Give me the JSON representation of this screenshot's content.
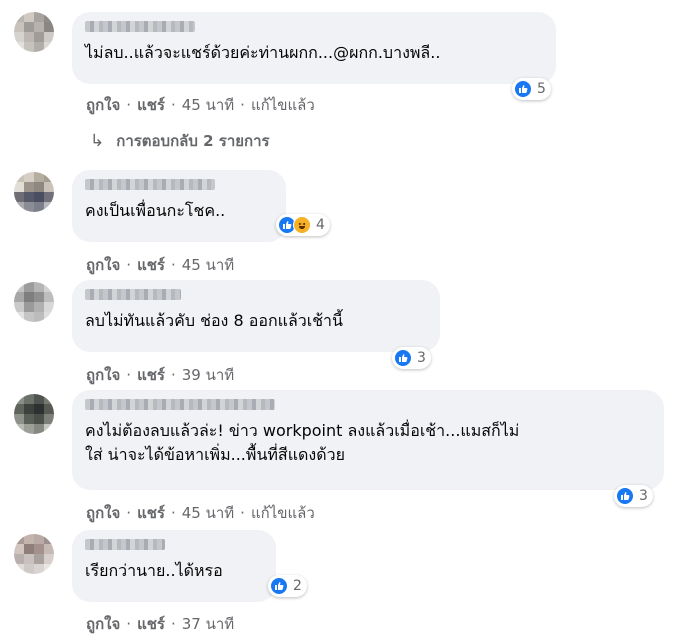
{
  "comments": [
    {
      "text": "ไม่ลบ..แล้วจะแชร์ด้วยค่ะท่านผกก...@ผกก.บางพลี..",
      "reactions": {
        "types": [
          "like"
        ],
        "count": "5"
      },
      "actions": {
        "like": "ถูกใจ",
        "share": "แชร์",
        "time": "45 นาที",
        "edited": "แก้ไขแล้ว"
      },
      "avatar_colors": [
        "#b9b6b1",
        "#cfcac4",
        "#a7a39e",
        "#8f8c88",
        "#c9c3bd",
        "#9f9b96",
        "#b7b2ad",
        "#8a8783",
        "#d6d2cd",
        "#bdb8b3",
        "#a09c98",
        "#cfcac6",
        "#e3e0dc",
        "#c6c2be",
        "#b1ada9",
        "#dcd9d5"
      ]
    },
    {
      "text": "คงเป็นเพื่อนกะโชค..",
      "reactions": {
        "types": [
          "like",
          "haha"
        ],
        "count": "4"
      },
      "actions": {
        "like": "ถูกใจ",
        "share": "แชร์",
        "time": "45 นาที"
      },
      "avatar_colors": [
        "#c8c2b8",
        "#d6cfc5",
        "#b5ad9f",
        "#a39d92",
        "#e2ddd5",
        "#9b958b",
        "#8d8880",
        "#c9c3ba",
        "#6e6d74",
        "#55596a",
        "#4a4e60",
        "#717079",
        "#a9a8ad",
        "#8a8c96",
        "#7c7f8a",
        "#b8b7bb"
      ]
    },
    {
      "text": "ลบไม่ทันแล้วคับ ช่อง 8 ออกแล้วเช้านี้",
      "reactions": {
        "types": [
          "like"
        ],
        "count": "3"
      },
      "actions": {
        "like": "ถูกใจ",
        "share": "แชร์",
        "time": "39 นาที"
      },
      "avatar_colors": [
        "#c3c3c3",
        "#9c9c9c",
        "#b5b5b5",
        "#d1d1d1",
        "#a7a7a7",
        "#7e7e7e",
        "#8f8f8f",
        "#bdbdbd",
        "#cacaca",
        "#9a9a9a",
        "#b0b0b0",
        "#d8d8d8",
        "#e2e2e2",
        "#c5c5c5",
        "#bcbcbc",
        "#dedede"
      ]
    },
    {
      "text": "คงไม่ต้องลบแล้วล่ะ! ข่าว workpoint ลงแล้วเมื่อเช้า...แมสก็ไม่\nใส่ น่าจะได้ข้อหาเพิ่ม...พื้นที่สีแดงด้วย",
      "reactions": {
        "types": [
          "like"
        ],
        "count": "3"
      },
      "actions": {
        "like": "ถูกใจ",
        "share": "แชร์",
        "time": "45 นาที",
        "edited": "แก้ไขแล้ว"
      },
      "avatar_colors": [
        "#8a8f86",
        "#6c7169",
        "#4f5450",
        "#767a72",
        "#5f645c",
        "#3d423f",
        "#2d3130",
        "#565a53",
        "#8e9289",
        "#5a5f58",
        "#4b4f4a",
        "#7c8078",
        "#b7bab3",
        "#9da099",
        "#858981",
        "#c5c8c1"
      ]
    },
    {
      "text": "เรียกว่านาย..ได้หรอ",
      "reactions": {
        "types": [
          "like"
        ],
        "count": "2"
      },
      "actions": {
        "like": "ถูกใจ",
        "share": "แชร์",
        "time": "37 นาที"
      },
      "avatar_colors": [
        "#a89a96",
        "#c4b4ae",
        "#b9aaa5",
        "#9e908c",
        "#d2c5c0",
        "#8e7f7b",
        "#a3918c",
        "#c7bab5",
        "#b8b0ae",
        "#c9c1be",
        "#a9a19e",
        "#d6cfcc",
        "#e0dcda",
        "#cfcac8",
        "#d9d4d2",
        "#e8e5e3"
      ]
    }
  ],
  "replies": {
    "label": "การตอบกลับ 2 รายการ"
  },
  "icons": {
    "like": "thumbs-up-icon",
    "haha": "haha-emoji-icon",
    "reply_arrow": "reply-arrow-icon"
  },
  "colors": {
    "like_blue": "#1877f2",
    "bubble_bg": "#f0f2f5",
    "meta_gray": "#65676b"
  }
}
